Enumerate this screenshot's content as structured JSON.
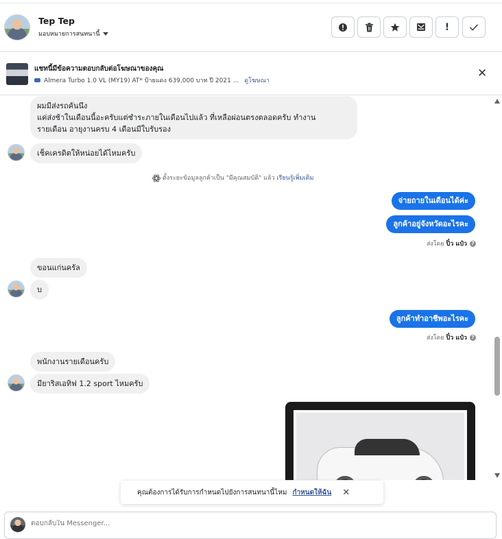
{
  "header": {
    "name": "Tep Tep",
    "assign_label": "มอบหมายการสนทนานี้",
    "buttons": [
      "!",
      "trash",
      "star",
      "mail",
      "!",
      "✓"
    ]
  },
  "ad": {
    "title": "แชทนี้มีข้อความตอบกลับต่อโฆษณาของคุณ",
    "subtitle": "Almera Turbo 1.0 VL (MY19) AT* ป้ายแดง 639,000 บาท ปี 2021 ...",
    "link": "ดูโฆษณา"
  },
  "messages": {
    "m1_line1": "ผมมีส่งรถคันนึง",
    "m1_line2": "แค่ส่งช้าในเดือนนี้อะครับแต่ชำระภายในเดือนไปแล้ว ที่เหลือผ่อนตรงตลอดครับ ทำงาน",
    "m1_line3": "รายเดือน อายุงานครบ 4 เดือนมีใบรับรอง",
    "m2": "เช็คเครดิตให้หน่อยได้ไหมครับ",
    "system_text": "ตั้งระยะข้อมูลลูกค้าเป็น \"มีคุณสมบัติ\" แล้ว",
    "system_link": "เรียนรู้เพิ่มเติม",
    "out1": "จ่ายถายในเดือนได้ค่ะ",
    "out2": "ลูกค้าอยู่จังหวัดอะไรคะ",
    "sent_by_label": "ส่งโดย",
    "sent_by_name": "ปิ๋ว แป๋ว",
    "m3": "ขอนแก่นครัล",
    "m4": "บ",
    "out3": "ลูกค้าทำอาชีพอะไรคะ",
    "m5": "พนักงานรายเดือนครับ",
    "m6": "มียาริสเอทิฟ 1.2 sport ไหมครับ"
  },
  "toast": {
    "text": "คุณต้องการได้รับการกำหนดไปยังการสนทนานี้ไหม",
    "link": "กำหนดให้ฉัน"
  },
  "composer": {
    "placeholder": "ตอบกลับใน Messenger..."
  }
}
